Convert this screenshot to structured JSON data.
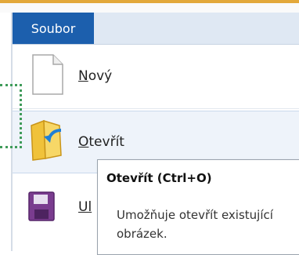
{
  "ribbon": {
    "file_tab_label": "Soubor"
  },
  "menu": {
    "items": [
      {
        "label_first": "N",
        "label_rest": "ový",
        "icon": "new-document-icon"
      },
      {
        "label_first": "O",
        "label_rest": "tevřít",
        "icon": "open-folder-icon"
      },
      {
        "label_first": "Ul",
        "label_rest": "",
        "icon": "save-disk-icon"
      }
    ]
  },
  "tooltip": {
    "title": "Otevřít (Ctrl+O)",
    "body": "Umožňuje otevřít existující obrázek."
  },
  "colors": {
    "file_tab": "#1c5fad",
    "accent": "#e3a83a",
    "callout": "#3f9b5a",
    "ribbon": "#dfe8f3"
  }
}
